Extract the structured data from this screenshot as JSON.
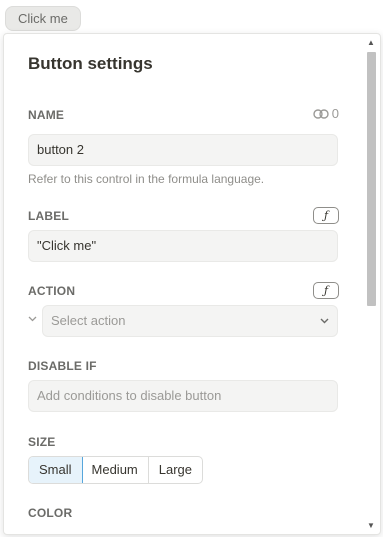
{
  "preview": {
    "button_label": "Click me"
  },
  "panel": {
    "title": "Button settings",
    "name": {
      "label": "NAME",
      "link_count": "0",
      "value": "button 2",
      "hint": "Refer to this control in the formula language."
    },
    "label": {
      "label": "LABEL",
      "fx": "ƒ",
      "value": "\"Click me\""
    },
    "action": {
      "label": "ACTION",
      "fx": "ƒ",
      "placeholder": "Select action",
      "chevron": "⌄"
    },
    "disable_if": {
      "label": "DISABLE IF",
      "placeholder": "Add conditions to disable button"
    },
    "size": {
      "label": "SIZE",
      "options": [
        "Small",
        "Medium",
        "Large"
      ],
      "selected": "Small"
    },
    "color": {
      "label": "COLOR"
    }
  },
  "scrollbar": {
    "up": "▲",
    "down": "▼"
  },
  "icons": {
    "link": "link-icon",
    "fx": "function-icon",
    "chevron": "chevron-down-icon"
  },
  "colors": {
    "selected_border": "#56a6dc",
    "selected_bg": "#e7f3fb"
  }
}
